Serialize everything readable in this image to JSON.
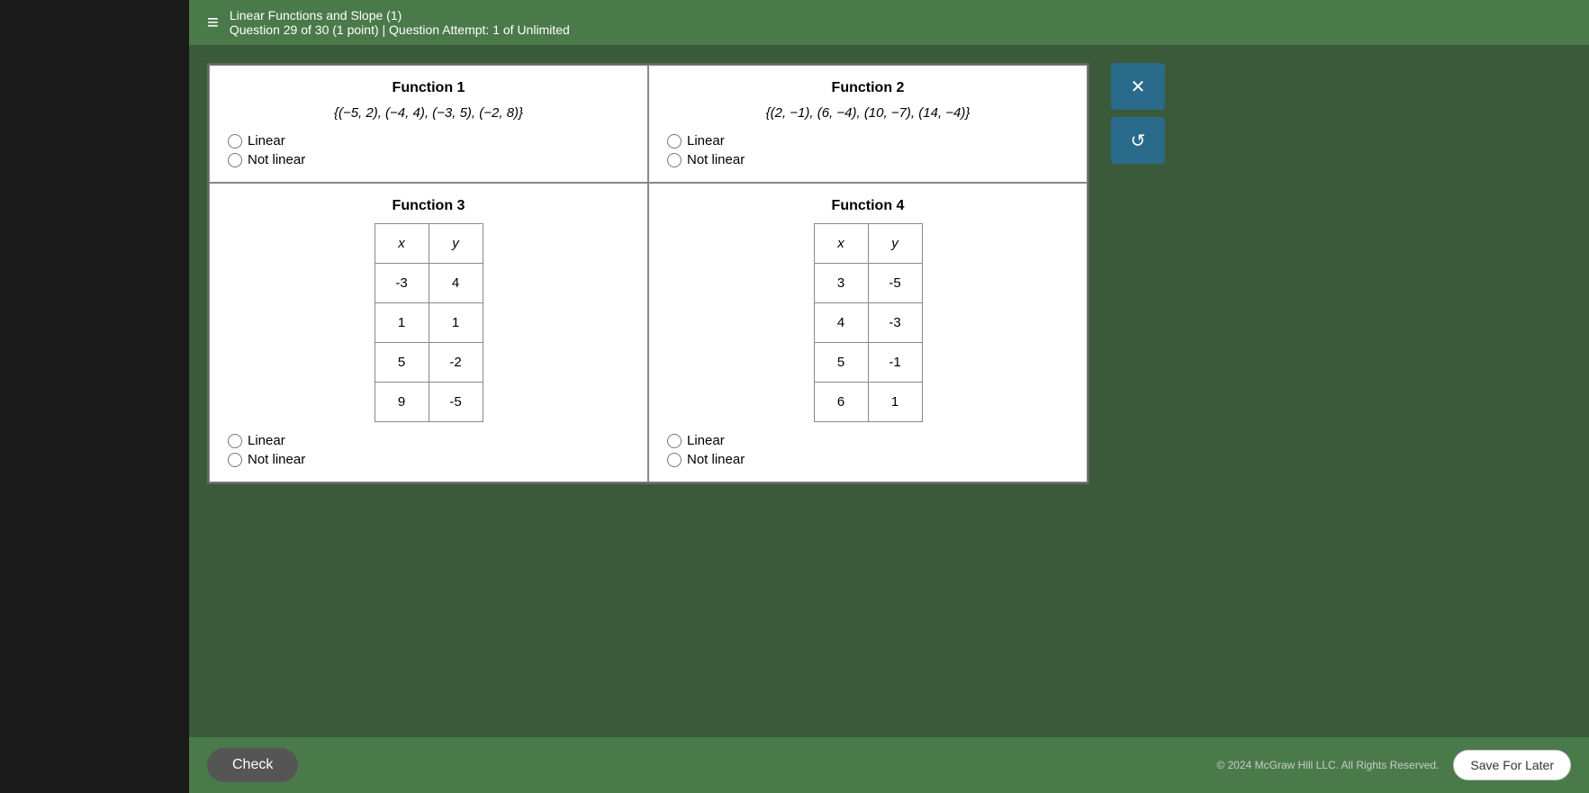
{
  "sidebar": {},
  "topbar": {
    "hamburger": "≡",
    "title": "Linear Functions and Slope (1)",
    "question_info": "Question 29 of 30 (1 point)  |  Question Attempt: 1 of Unlimited"
  },
  "functions": {
    "function1": {
      "title": "Function 1",
      "data": "{(−5, 2), (−4, 4), (−3, 5), (−2, 8)}",
      "options": [
        "Linear",
        "Not linear"
      ]
    },
    "function2": {
      "title": "Function 2",
      "data": "{(2, −1), (6, −4), (10, −7), (14, −4)}",
      "options": [
        "Linear",
        "Not linear"
      ]
    },
    "function3": {
      "title": "Function 3",
      "table_headers": [
        "x",
        "y"
      ],
      "table_rows": [
        [
          "-3",
          "4"
        ],
        [
          "1",
          "1"
        ],
        [
          "5",
          "-2"
        ],
        [
          "9",
          "-5"
        ]
      ],
      "options": [
        "Linear",
        "Not linear"
      ]
    },
    "function4": {
      "title": "Function 4",
      "table_headers": [
        "x",
        "y"
      ],
      "table_rows": [
        [
          "3",
          "-5"
        ],
        [
          "4",
          "-3"
        ],
        [
          "5",
          "-1"
        ],
        [
          "6",
          "1"
        ]
      ],
      "options": [
        "Linear",
        "Not linear"
      ]
    }
  },
  "buttons": {
    "x_label": "✕",
    "undo_label": "↺",
    "check_label": "Check",
    "save_label": "Save For Later"
  },
  "footer": {
    "copyright": "© 2024 McGraw Hill LLC. All Rights Reserved."
  }
}
